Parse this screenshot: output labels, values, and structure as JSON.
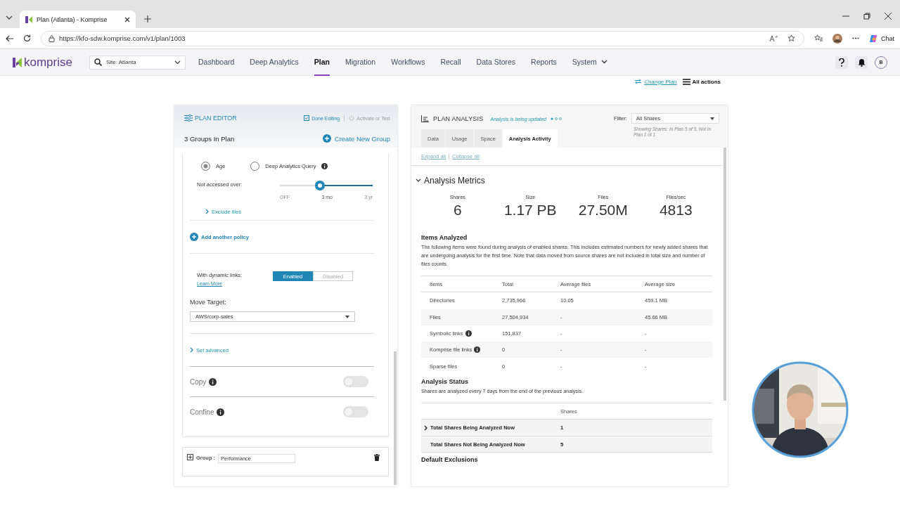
{
  "browser": {
    "tab_title": "Plan (Atlanta) - Komprise",
    "url": "https://kfo-sdw.komprise.com/v1/plan/1003",
    "chat_label": "Chat"
  },
  "nav": {
    "logo_text": "komprise",
    "site_search": "Site: Atlanta",
    "avatar": "B",
    "items": [
      {
        "label": "Dashboard",
        "selected": false,
        "dropdown": false
      },
      {
        "label": "Deep Analytics",
        "selected": false,
        "dropdown": false
      },
      {
        "label": "Plan",
        "selected": true,
        "dropdown": false
      },
      {
        "label": "Migration",
        "selected": false,
        "dropdown": false
      },
      {
        "label": "Workflows",
        "selected": false,
        "dropdown": false
      },
      {
        "label": "Recall",
        "selected": false,
        "dropdown": false
      },
      {
        "label": "Data Stores",
        "selected": false,
        "dropdown": false
      },
      {
        "label": "Reports",
        "selected": false,
        "dropdown": false
      },
      {
        "label": "System",
        "selected": false,
        "dropdown": true
      }
    ]
  },
  "toolbar": {
    "change_plan": "Change Plan",
    "all_actions": "All actions"
  },
  "plan_editor": {
    "title": "PLAN EDITOR",
    "done_editing": "Done Editing",
    "activate": {
      "label": "Activate or Test",
      "disabled": true
    },
    "groups_count": "3 Groups In Plan",
    "create_group": "Create New Group",
    "policy_options": [
      {
        "label": "Age",
        "selected": true,
        "info": false
      },
      {
        "label": "Deep Analytics Query",
        "selected": false,
        "info": true
      }
    ],
    "slider": {
      "label": "Not accessed over:",
      "level": 0.565,
      "ticks": [
        {
          "label": "OFF",
          "selected": false
        },
        {
          "label": "3 mo",
          "selected": true
        },
        {
          "label": "3 yr",
          "selected": false
        }
      ]
    },
    "exclude_files": "Exclude files",
    "add_policy": "Add another policy",
    "dynamic_links": {
      "label": "With dynamic links:",
      "learn_more": "Learn More",
      "options": [
        {
          "label": "Enabled",
          "selected": true
        },
        {
          "label": "Disabled",
          "selected": false
        }
      ]
    },
    "move_target": {
      "label": "Move Target:",
      "value": "AWS/corp-sales"
    },
    "set_advanced": "Set advanced",
    "toggles": [
      {
        "label": "Copy",
        "on": false
      },
      {
        "label": "Confine",
        "on": false
      }
    ],
    "group": {
      "label": "Group :",
      "value": "Performance"
    }
  },
  "plan_analysis": {
    "title": "PLAN ANALYSIS",
    "status": "Analysis is being updated",
    "filter": {
      "label": "Filter:",
      "value": "All Shares",
      "note": "Showing Shares: In Plan 5 of 5, Not In Plan 1 of 1"
    },
    "tabs": [
      {
        "label": "Data",
        "selected": false
      },
      {
        "label": "Usage",
        "selected": false
      },
      {
        "label": "Space",
        "selected": false
      },
      {
        "label": "Analysis Activity",
        "selected": true
      }
    ],
    "expand_all": "Expand all",
    "collapse_all": "Collapse all",
    "section_title": "Analysis Metrics",
    "section_expanded": true,
    "metrics": [
      {
        "label": "Shares",
        "value": "6"
      },
      {
        "label": "Size",
        "value": "1.17 PB"
      },
      {
        "label": "Files",
        "value": "27.50M"
      },
      {
        "label": "Files/sec",
        "value": "4813"
      }
    ],
    "items_title": "Items Analyzed",
    "items_description": "The following items were found during analysis of enabled shares. This includes estimated numbers for newly added shares that are undergoing analysis for the first time. Note that data moved from source shares are not included in total size and number of files counts.",
    "items_table": {
      "columns": [
        "Items",
        "Total",
        "Average files",
        "Average size"
      ],
      "rows": [
        {
          "cells": [
            "Directories",
            "2,735,966",
            "10.05",
            "459.1 MB"
          ],
          "info": false
        },
        {
          "cells": [
            "Files",
            "27,504,934",
            "-",
            "45.66 MB"
          ],
          "info": false
        },
        {
          "cells": [
            "Symbolic links",
            "151,837",
            "-",
            "-"
          ],
          "info": true
        },
        {
          "cells": [
            "Komprise file links",
            "0",
            "-",
            "-"
          ],
          "info": true
        },
        {
          "cells": [
            "Sparse files",
            "0",
            "-",
            "-"
          ],
          "info": false
        }
      ]
    },
    "status_title": "Analysis Status",
    "status_note": "Shares are analyzed every 7 days from the end of the previous analysis.",
    "status_table": {
      "column": "Shares",
      "rows": [
        {
          "label": "Total Shares Being Analyzed Now",
          "value": "1",
          "expandable": true
        },
        {
          "label": "Total Shares Not Being Analyzed Now",
          "value": "5",
          "expandable": false
        }
      ]
    },
    "exclusions_title": "Default Exclusions"
  }
}
